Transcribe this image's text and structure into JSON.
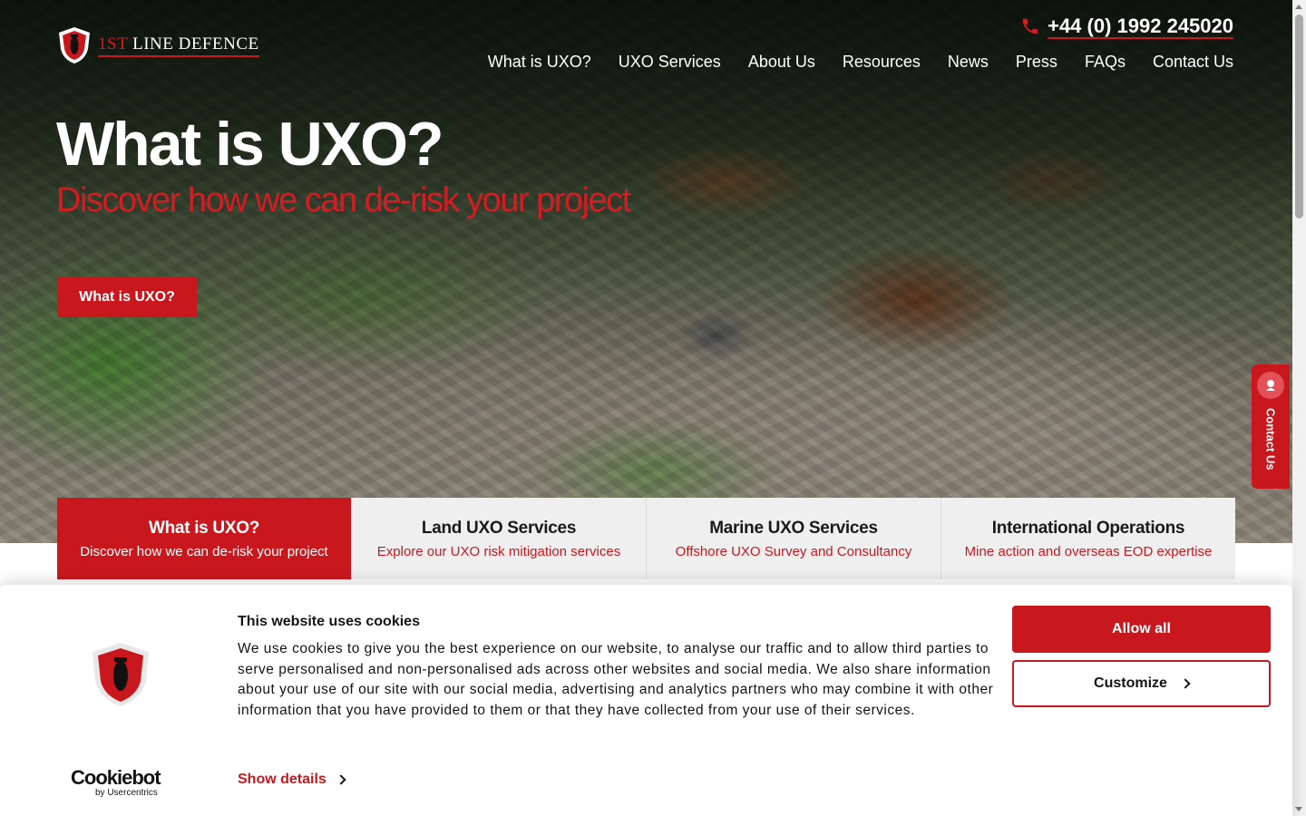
{
  "colors": {
    "brand_red": "#c8181e",
    "text_dark": "#141414",
    "card_bg": "#efefef"
  },
  "header": {
    "logo_text_prefix": "1ST",
    "logo_text_rest": " LINE DEFENCE",
    "logo_icon": "shield-bomb-logo",
    "phone": "+44 (0) 1992 245020",
    "phone_icon": "phone-icon"
  },
  "nav": {
    "items": [
      {
        "label": "What is UXO?"
      },
      {
        "label": "UXO Services"
      },
      {
        "label": "About Us"
      },
      {
        "label": "Resources"
      },
      {
        "label": "News"
      },
      {
        "label": "Press"
      },
      {
        "label": "FAQs"
      },
      {
        "label": "Contact Us"
      }
    ]
  },
  "hero": {
    "title": "What is UXO?",
    "subtitle": "Discover how we can de-risk your project",
    "button_label": "What is UXO?"
  },
  "side_tab": {
    "label": "Contact Us",
    "icon": "contact-chat-icon"
  },
  "cards": [
    {
      "title": "What is UXO?",
      "subtitle": "Discover how we can de-risk your project",
      "active": true
    },
    {
      "title": "Land UXO Services",
      "subtitle": "Explore our UXO risk mitigation services",
      "active": false
    },
    {
      "title": "Marine UXO Services",
      "subtitle": "Offshore UXO Survey and Consultancy",
      "active": false
    },
    {
      "title": "International Operations",
      "subtitle": "Mine action and overseas EOD expertise",
      "active": false
    }
  ],
  "cookie": {
    "title": "This website uses cookies",
    "body": "We use cookies to give you the best experience on our website, to analyse our traffic and to allow third parties to serve personalised and non-personalised ads across other websites and social media. We also share information about your use of our site with our social media, advertising and analytics partners who may combine it with other information that you have provided to them or that they have collected from your use of their services.",
    "show_details": "Show details",
    "allow_all": "Allow all",
    "customize": "Customize",
    "provider_name": "Cookiebot",
    "provider_by": "by Usercentrics"
  }
}
